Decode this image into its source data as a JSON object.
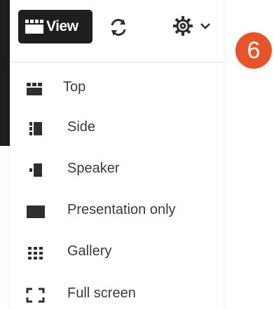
{
  "toolbar": {
    "view_label": "View",
    "view_icon": "grid-layout-icon",
    "swap_icon": "swap-icon",
    "settings_icon": "gear-icon",
    "dropdown_icon": "chevron-down-icon"
  },
  "badge": {
    "number": "6",
    "color": "#e7542a"
  },
  "menu": {
    "items": [
      {
        "label": "Top",
        "icon": "layout-top-icon"
      },
      {
        "label": "Side",
        "icon": "layout-side-icon"
      },
      {
        "label": "Speaker",
        "icon": "layout-speaker-icon"
      },
      {
        "label": "Presentation only",
        "icon": "presentation-icon"
      },
      {
        "label": "Gallery",
        "icon": "gallery-icon"
      },
      {
        "label": "Full screen",
        "icon": "fullscreen-icon"
      }
    ]
  },
  "colors": {
    "icon": "#2f2f2f",
    "text": "#3a3a3a",
    "button_bg": "#1e1e1e"
  }
}
